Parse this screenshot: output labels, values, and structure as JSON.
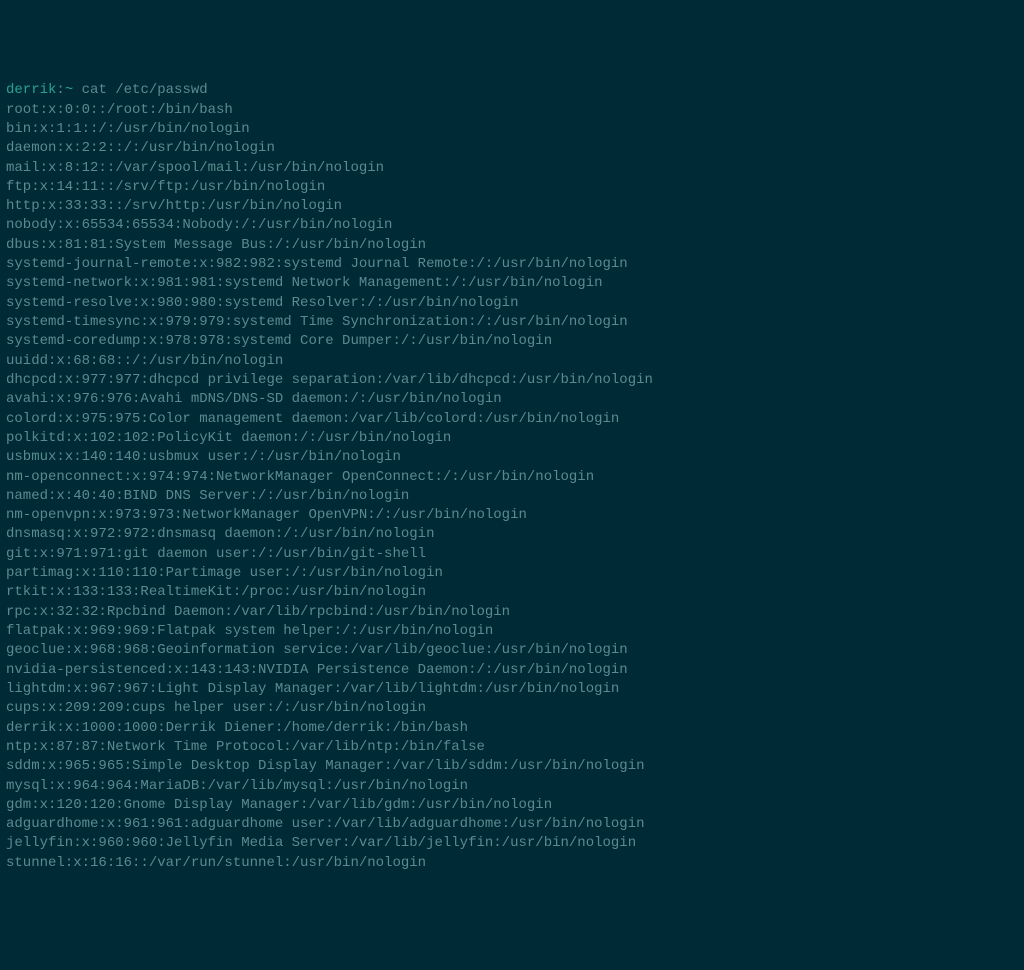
{
  "prompt": {
    "user": "derrik",
    "sep": ":",
    "path": "~",
    "command": " cat /etc/passwd"
  },
  "lines": [
    "root:x:0:0::/root:/bin/bash",
    "bin:x:1:1::/:/usr/bin/nologin",
    "daemon:x:2:2::/:/usr/bin/nologin",
    "mail:x:8:12::/var/spool/mail:/usr/bin/nologin",
    "ftp:x:14:11::/srv/ftp:/usr/bin/nologin",
    "http:x:33:33::/srv/http:/usr/bin/nologin",
    "nobody:x:65534:65534:Nobody:/:/usr/bin/nologin",
    "dbus:x:81:81:System Message Bus:/:/usr/bin/nologin",
    "systemd-journal-remote:x:982:982:systemd Journal Remote:/:/usr/bin/nologin",
    "systemd-network:x:981:981:systemd Network Management:/:/usr/bin/nologin",
    "systemd-resolve:x:980:980:systemd Resolver:/:/usr/bin/nologin",
    "systemd-timesync:x:979:979:systemd Time Synchronization:/:/usr/bin/nologin",
    "systemd-coredump:x:978:978:systemd Core Dumper:/:/usr/bin/nologin",
    "uuidd:x:68:68::/:/usr/bin/nologin",
    "dhcpcd:x:977:977:dhcpcd privilege separation:/var/lib/dhcpcd:/usr/bin/nologin",
    "avahi:x:976:976:Avahi mDNS/DNS-SD daemon:/:/usr/bin/nologin",
    "colord:x:975:975:Color management daemon:/var/lib/colord:/usr/bin/nologin",
    "polkitd:x:102:102:PolicyKit daemon:/:/usr/bin/nologin",
    "usbmux:x:140:140:usbmux user:/:/usr/bin/nologin",
    "nm-openconnect:x:974:974:NetworkManager OpenConnect:/:/usr/bin/nologin",
    "named:x:40:40:BIND DNS Server:/:/usr/bin/nologin",
    "nm-openvpn:x:973:973:NetworkManager OpenVPN:/:/usr/bin/nologin",
    "dnsmasq:x:972:972:dnsmasq daemon:/:/usr/bin/nologin",
    "git:x:971:971:git daemon user:/:/usr/bin/git-shell",
    "partimag:x:110:110:Partimage user:/:/usr/bin/nologin",
    "rtkit:x:133:133:RealtimeKit:/proc:/usr/bin/nologin",
    "rpc:x:32:32:Rpcbind Daemon:/var/lib/rpcbind:/usr/bin/nologin",
    "flatpak:x:969:969:Flatpak system helper:/:/usr/bin/nologin",
    "geoclue:x:968:968:Geoinformation service:/var/lib/geoclue:/usr/bin/nologin",
    "nvidia-persistenced:x:143:143:NVIDIA Persistence Daemon:/:/usr/bin/nologin",
    "lightdm:x:967:967:Light Display Manager:/var/lib/lightdm:/usr/bin/nologin",
    "cups:x:209:209:cups helper user:/:/usr/bin/nologin",
    "derrik:x:1000:1000:Derrik Diener:/home/derrik:/bin/bash",
    "ntp:x:87:87:Network Time Protocol:/var/lib/ntp:/bin/false",
    "sddm:x:965:965:Simple Desktop Display Manager:/var/lib/sddm:/usr/bin/nologin",
    "mysql:x:964:964:MariaDB:/var/lib/mysql:/usr/bin/nologin",
    "gdm:x:120:120:Gnome Display Manager:/var/lib/gdm:/usr/bin/nologin",
    "adguardhome:x:961:961:adguardhome user:/var/lib/adguardhome:/usr/bin/nologin",
    "jellyfin:x:960:960:Jellyfin Media Server:/var/lib/jellyfin:/usr/bin/nologin",
    "stunnel:x:16:16::/var/run/stunnel:/usr/bin/nologin"
  ]
}
